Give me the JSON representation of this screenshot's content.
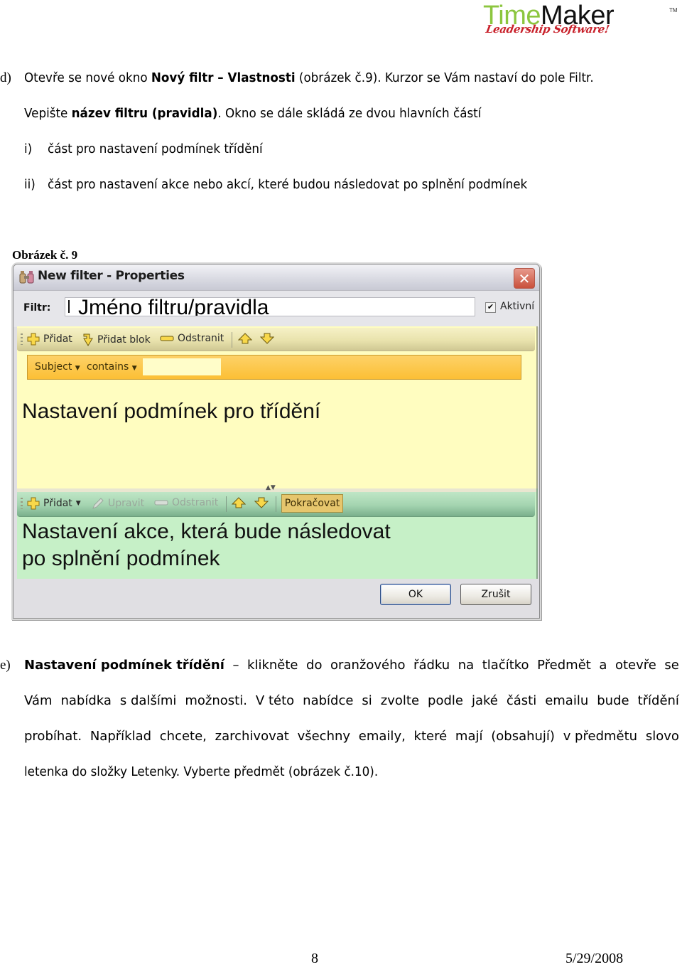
{
  "logo": {
    "brand_part1": "Time",
    "brand_part2": "Maker",
    "trademark": "TM",
    "tagline": "Leadership Software!",
    "colors": {
      "time": "#8cc63f",
      "maker": "#111111",
      "tagline": "#c8202a"
    }
  },
  "section_d": {
    "marker": "d)",
    "line1": {
      "pre": "Otevře se nové okno ",
      "bold": "Nový filtr – Vlastnosti",
      "post": " (obrázek č.9). Kurzor se Vám nastaví do pole Filtr."
    },
    "line2": {
      "pre": "Vepište ",
      "bold": "název filtru (pravidla)",
      "post": ". Okno se dále skládá ze dvou hlavních částí"
    },
    "items": [
      {
        "marker": "i)",
        "text": "část pro nastavení podmínek třídění"
      },
      {
        "marker": "ii)",
        "text": "část pro nastavení akce nebo akcí, které budou následovat po splnění podmínek"
      }
    ]
  },
  "figure": {
    "caption": "Obrázek č. 9",
    "dialog": {
      "title": "New filter - Properties",
      "filter_label": "Filtr:",
      "filter_value": "Jméno filtru/pravidla",
      "active_label": "Aktivní",
      "active_checked": true,
      "condition_toolbar": {
        "add": "Přidat",
        "add_block": "Přidat blok",
        "remove": "Odstranit"
      },
      "condition_row": {
        "field": "Subject",
        "operator": "contains",
        "value": ""
      },
      "condition_annotation": "Nastavení podmínek pro třídění",
      "action_toolbar": {
        "add": "Přidat",
        "edit": "Upravit",
        "remove": "Odstranit",
        "continue": "Pokračovat"
      },
      "action_annotation_line1": "Nastavení akce, která bude následovat",
      "action_annotation_line2": "po splnění podmínek",
      "ok_label": "OK",
      "cancel_label": "Zrušit"
    }
  },
  "section_e": {
    "marker": "e)",
    "line1_bold": "Nastavení podmínek třídění",
    "line1_dash": "–",
    "line1_words": [
      "klikněte",
      "do",
      "oranžového",
      "řádku",
      "na",
      "tlačítko",
      "Předmět",
      "a",
      "otevře",
      "se"
    ],
    "line2_words": [
      "Vám",
      "nabídka",
      "s dalšími",
      "možnosti.",
      "V této",
      "nabídce",
      "si",
      "zvolte",
      "podle",
      "jaké",
      "části",
      "emailu",
      "bude",
      "třídění"
    ],
    "line3_words": [
      "probíhat.",
      "Například",
      "chcete,",
      "zarchivovat",
      "všechny",
      "emaily,",
      "které",
      "mají",
      "(obsahují)",
      "v předmětu",
      "slovo"
    ],
    "line4": "letenka do složky Letenky. Vyberte předmět (obrázek č.10)."
  },
  "footer": {
    "page_number": "8",
    "date": "5/29/2008"
  }
}
